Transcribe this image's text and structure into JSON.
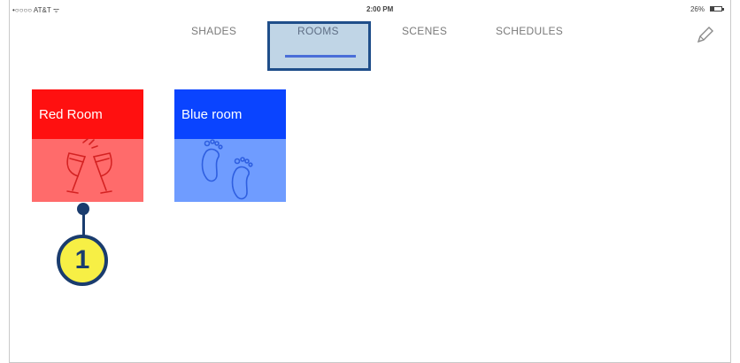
{
  "status_bar": {
    "carrier": "•○○○○ AT&T ᯤ",
    "time": "2:00 PM",
    "battery": "26%"
  },
  "tabs": [
    {
      "label": "SHADES",
      "selected": false
    },
    {
      "label": "ROOMS",
      "selected": true
    },
    {
      "label": "SCENES",
      "selected": false
    },
    {
      "label": "SCHEDULES",
      "selected": false
    }
  ],
  "edit_icon": "pencil-icon",
  "rooms": [
    {
      "name": "Red Room",
      "icon": "champagne-glasses-icon",
      "color_top": "#ff1010",
      "color_bottom": "#ff6b6b"
    },
    {
      "name": "Blue room",
      "icon": "footprints-icon",
      "color_top": "#0a44ff",
      "color_bottom": "#6f9cff"
    }
  ],
  "callout": {
    "number": "1"
  },
  "colors": {
    "accent": "#4b6ed8",
    "highlight_border": "#1f4e8a",
    "callout_fill": "#f7ef45"
  }
}
